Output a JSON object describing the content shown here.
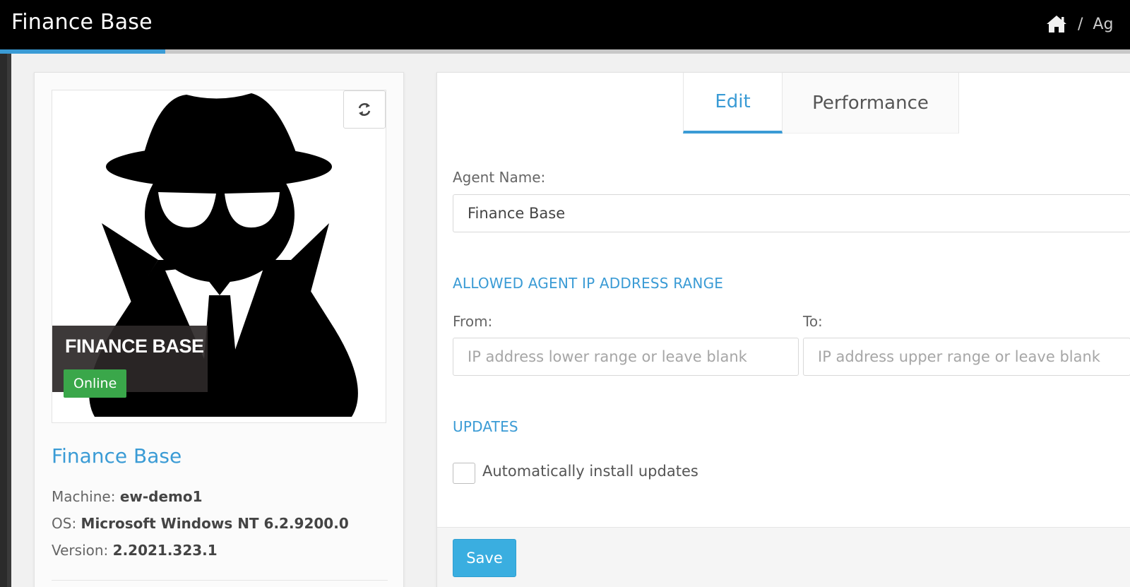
{
  "header": {
    "title": "Finance Base",
    "breadcrumb_separator": "/",
    "breadcrumb_next": "Ag"
  },
  "page_progress": 0.146,
  "agent_card": {
    "overlay_name": "FINANCE BASE",
    "status": "Online",
    "agent_name": "Finance Base",
    "machine_label": "Machine:",
    "machine_value": "ew-demo1",
    "os_label": "OS:",
    "os_value": "Microsoft Windows NT 6.2.9200.0",
    "version_label": "Version:",
    "version_value": "2.2021.323.1"
  },
  "tabs": [
    {
      "label": "Edit",
      "active": true
    },
    {
      "label": "Performance",
      "active": false
    }
  ],
  "form": {
    "agent_name_label": "Agent Name:",
    "agent_name_value": "Finance Base",
    "ip_section_title": "ALLOWED AGENT IP ADDRESS RANGE",
    "from_label": "From:",
    "from_placeholder": "IP address lower range or leave blank",
    "to_label": "To:",
    "to_placeholder": "IP address upper range or leave blank",
    "updates_section_title": "UPDATES",
    "auto_update_label": "Automatically install updates",
    "save_label": "Save"
  },
  "colors": {
    "accent": "#3a9bd5",
    "online": "#3aa74a",
    "topbar": "#000000"
  }
}
